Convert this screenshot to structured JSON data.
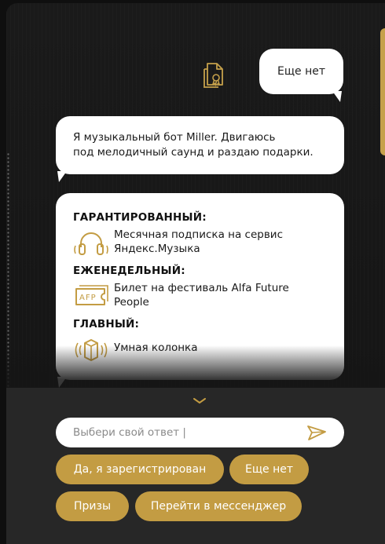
{
  "messages": {
    "user_reply": "Еще нет",
    "bot_intro": [
      "Я музыкальный бот Miller. Двигаюсь",
      "под мелодичный саунд и раздаю подарки."
    ],
    "prizes": [
      {
        "heading": "ГАРАНТИРОВАННЫЙ:",
        "lines": [
          "Месячная подписка на сервис",
          "Яндекс.Музыка"
        ],
        "icon": "headphones-icon"
      },
      {
        "heading": "ЕЖЕНЕДЕЛЬНЫЙ:",
        "lines": [
          "Билет на фестиваль Alfa Future",
          "People"
        ],
        "icon": "afp-ticket-icon",
        "icon_text": "AFP"
      },
      {
        "heading": "ГЛАВНЫЙ:",
        "lines": [
          "Умная колонка"
        ],
        "icon": "smart-speaker-icon"
      }
    ]
  },
  "input": {
    "placeholder": "Выбери свой ответ |"
  },
  "quick_replies": [
    "Да, я зарегистрирован",
    "Еще нет",
    "Призы",
    "Перейти в мессенджер"
  ],
  "icons": {
    "document": "document-award-icon",
    "expand": "chevron-down-icon",
    "send": "send-icon"
  },
  "colors": {
    "accent": "#c39c43",
    "background": "#151515",
    "panel": "#272727",
    "bubble": "#ffffff"
  }
}
